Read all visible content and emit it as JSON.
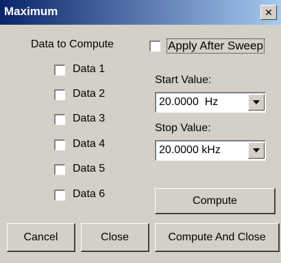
{
  "window": {
    "title": "Maximum",
    "close_glyph": "✕"
  },
  "compute_group": {
    "heading": "Data to Compute",
    "items": [
      {
        "label": "Data 1",
        "checked": false
      },
      {
        "label": "Data 2",
        "checked": false
      },
      {
        "label": "Data 3",
        "checked": false
      },
      {
        "label": "Data 4",
        "checked": false
      },
      {
        "label": "Data 5",
        "checked": false
      },
      {
        "label": "Data 6",
        "checked": false
      }
    ]
  },
  "apply_after_sweep": {
    "label": "Apply After Sweep",
    "checked": false
  },
  "start": {
    "label": "Start Value:",
    "value": "20.0000  Hz"
  },
  "stop": {
    "label": "Stop Value:",
    "value": "20.0000 kHz"
  },
  "buttons": {
    "compute": "Compute",
    "cancel": "Cancel",
    "close": "Close",
    "compute_and_close": "Compute And Close"
  },
  "colors": {
    "titlebar_start": "#0a246a",
    "titlebar_end": "#a6caf0",
    "face": "#d4d0c8"
  }
}
